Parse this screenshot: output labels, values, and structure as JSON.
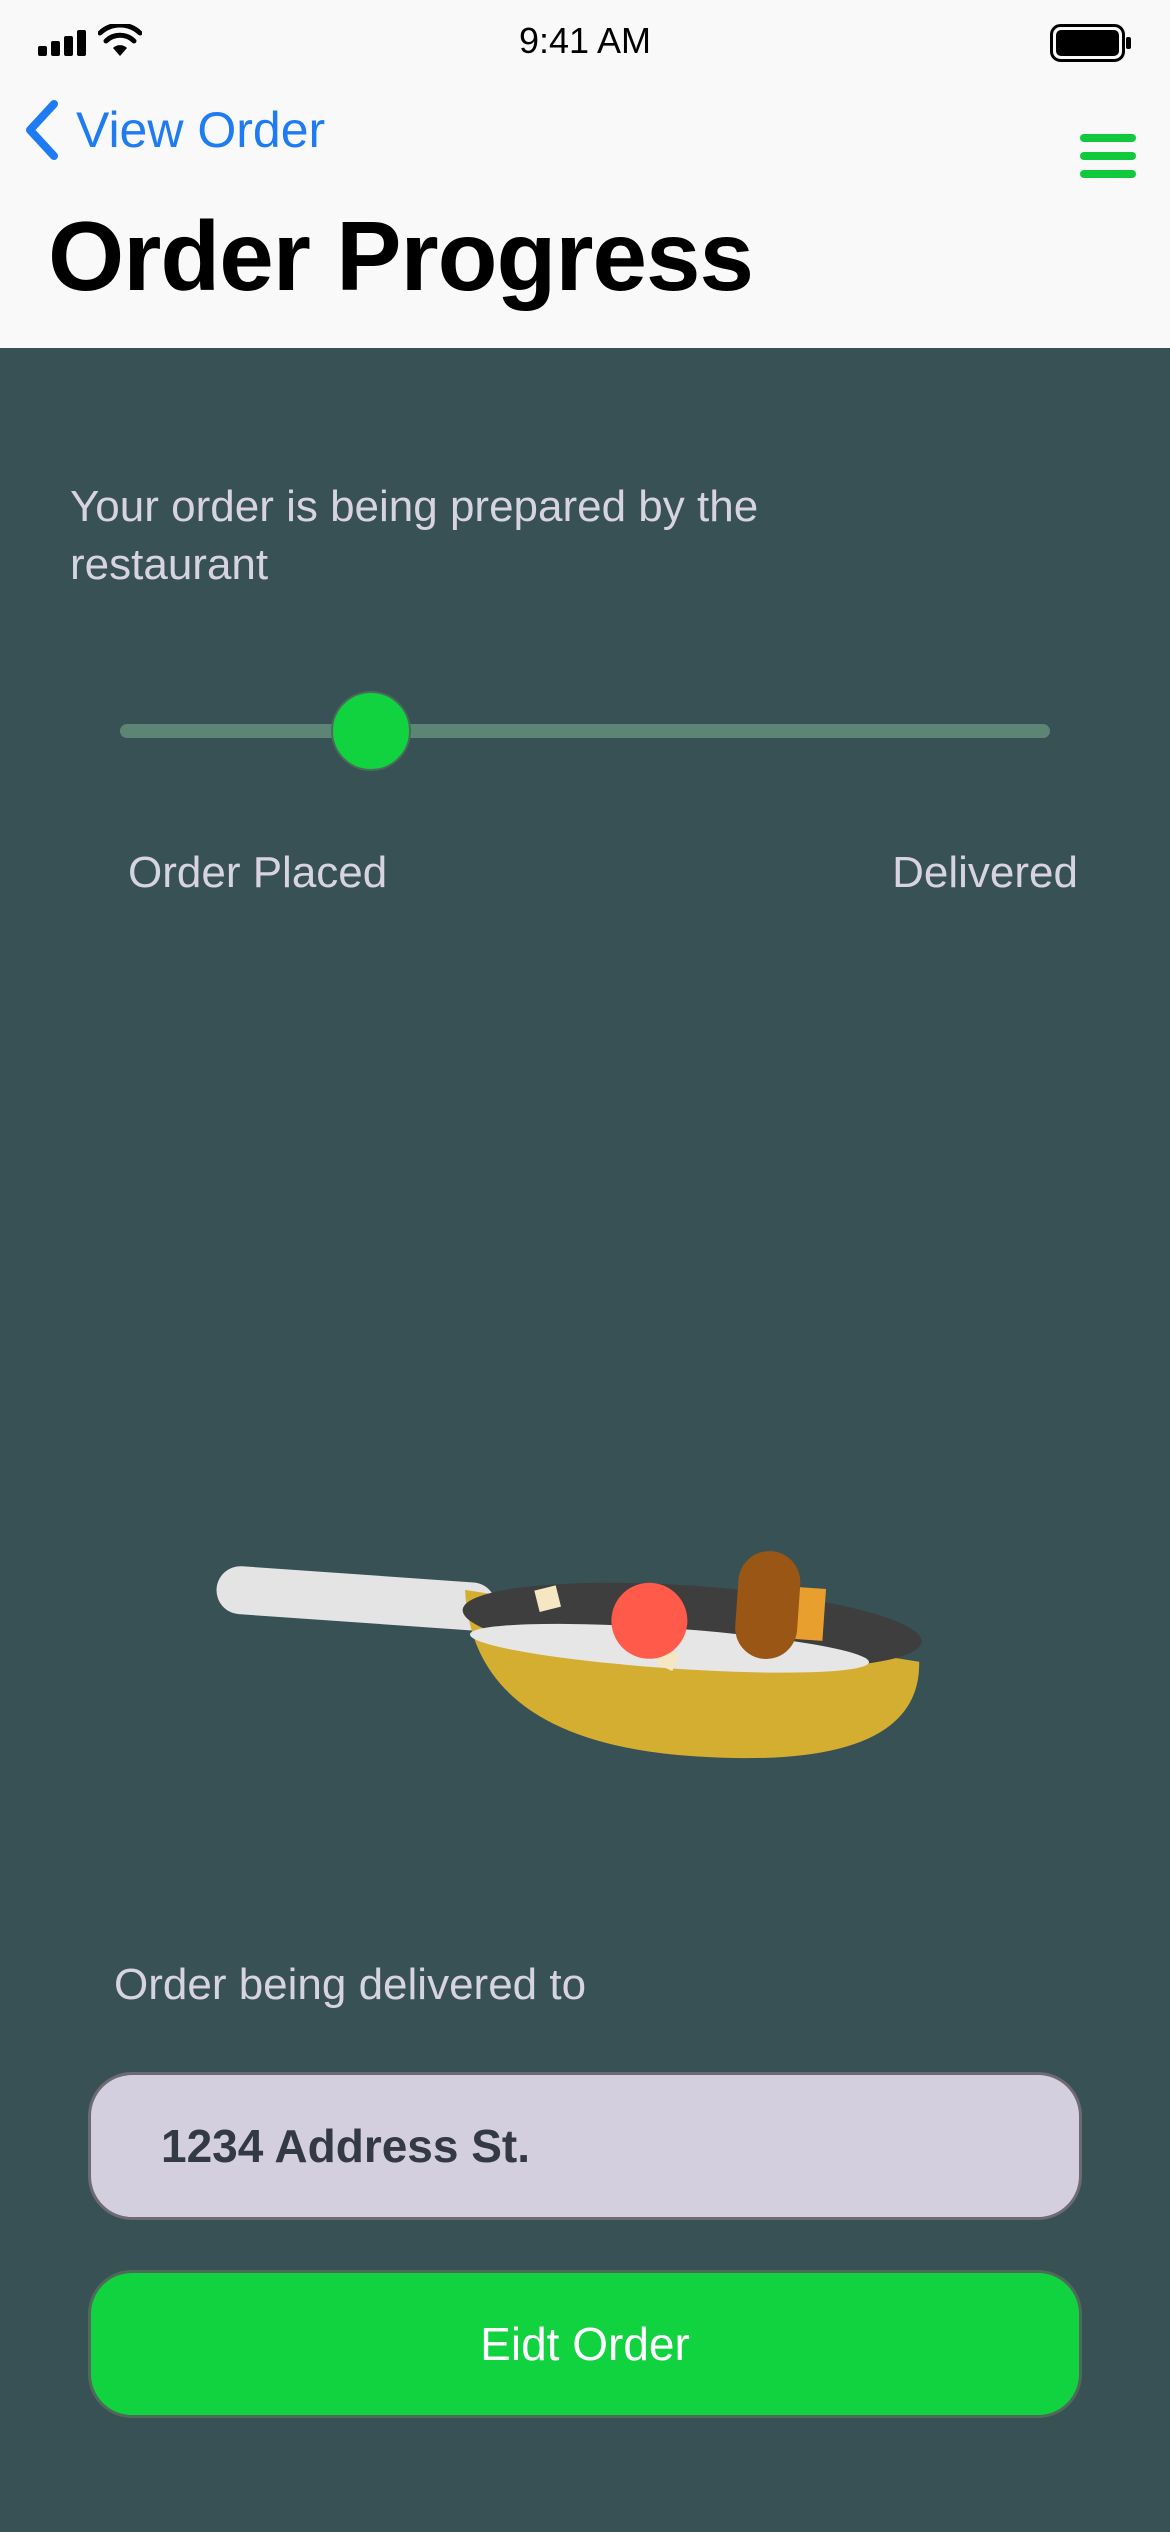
{
  "status_bar": {
    "time": "9:41 AM"
  },
  "nav": {
    "back_label": "View Order",
    "title": "Order Progress",
    "icons": {
      "back": "chevron-left-icon",
      "menu": "hamburger-menu-icon"
    }
  },
  "progress": {
    "message": "Your order is being prepared by the restaurant",
    "start_label": "Order Placed",
    "end_label": "Delivered",
    "value": 0.27
  },
  "delivery": {
    "caption": "Order being delivered to",
    "address": "1234 Address St."
  },
  "actions": {
    "edit_label": "Eidt Order"
  },
  "colors": {
    "accent_blue": "#1e7bf2",
    "accent_green": "#11d33f",
    "background": "#385155",
    "text_light": "#d7d3e0"
  }
}
